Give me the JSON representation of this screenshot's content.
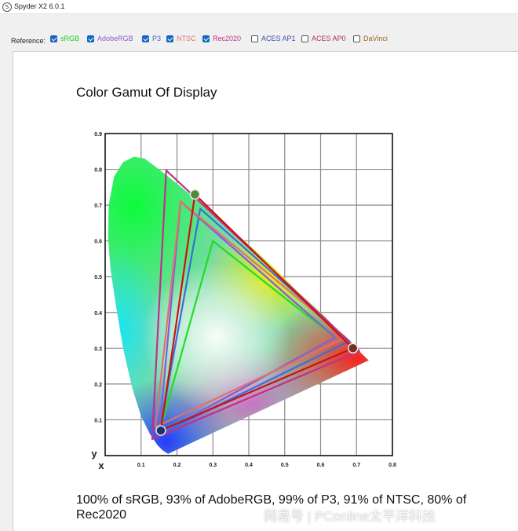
{
  "window": {
    "title": "Spyder X2 6.0.1",
    "icon": "spyder-icon"
  },
  "reference": {
    "label": "Reference:",
    "items": [
      {
        "label": "sRGB",
        "checked": true,
        "color": "#22cc22"
      },
      {
        "label": "AdobeRGB",
        "checked": true,
        "color": "#8a5ad8"
      },
      {
        "label": "P3",
        "checked": true,
        "color": "#3a6fd8"
      },
      {
        "label": "NTSC",
        "checked": true,
        "color": "#e07070"
      },
      {
        "label": "Rec2020",
        "checked": true,
        "color": "#c0308a"
      },
      {
        "label": "ACES AP1",
        "checked": false,
        "color": "#3a4fb0"
      },
      {
        "label": "ACES AP0",
        "checked": false,
        "color": "#b03050"
      },
      {
        "label": "DaVinci",
        "checked": false,
        "color": "#a06020"
      }
    ]
  },
  "main": {
    "heading": "Color Gamut Of Display",
    "summary": "100% of sRGB, 93% of AdobeRGB, 99% of P3, 91% of NTSC, 80% of Rec2020"
  },
  "watermark": "网易号 | PConline太平洋科技",
  "chart_data": {
    "type": "scatter",
    "title": "",
    "xlabel": "x",
    "ylabel": "y",
    "xlim": [
      0,
      0.8
    ],
    "ylim": [
      0,
      0.9
    ],
    "x_ticks": [
      "0.1",
      "0.2",
      "0.3",
      "0.4",
      "0.5",
      "0.6",
      "0.7",
      "0.8"
    ],
    "y_ticks": [
      "0.1",
      "0.2",
      "0.3",
      "0.4",
      "0.5",
      "0.6",
      "0.7",
      "0.8",
      "0.9"
    ],
    "grid": true,
    "gamuts": [
      {
        "name": "sRGB",
        "color": "#22dd22",
        "points": [
          [
            0.64,
            0.33
          ],
          [
            0.3,
            0.6
          ],
          [
            0.15,
            0.06
          ]
        ]
      },
      {
        "name": "AdobeRGB",
        "color": "#8a5ad8",
        "points": [
          [
            0.64,
            0.33
          ],
          [
            0.21,
            0.71
          ],
          [
            0.15,
            0.06
          ]
        ]
      },
      {
        "name": "P3",
        "color": "#3a6fd8",
        "points": [
          [
            0.68,
            0.32
          ],
          [
            0.265,
            0.69
          ],
          [
            0.15,
            0.06
          ]
        ]
      },
      {
        "name": "NTSC",
        "color": "#e07070",
        "points": [
          [
            0.67,
            0.33
          ],
          [
            0.21,
            0.71
          ],
          [
            0.14,
            0.08
          ]
        ]
      },
      {
        "name": "Rec2020",
        "color": "#c0308a",
        "points": [
          [
            0.708,
            0.292
          ],
          [
            0.17,
            0.797
          ],
          [
            0.131,
            0.046
          ]
        ]
      },
      {
        "name": "Display",
        "color": "#cc1111",
        "points": [
          [
            0.69,
            0.3
          ],
          [
            0.25,
            0.73
          ],
          [
            0.155,
            0.07
          ]
        ]
      }
    ],
    "display_primaries": [
      [
        0.69,
        0.3
      ],
      [
        0.25,
        0.73
      ],
      [
        0.155,
        0.07
      ]
    ]
  }
}
